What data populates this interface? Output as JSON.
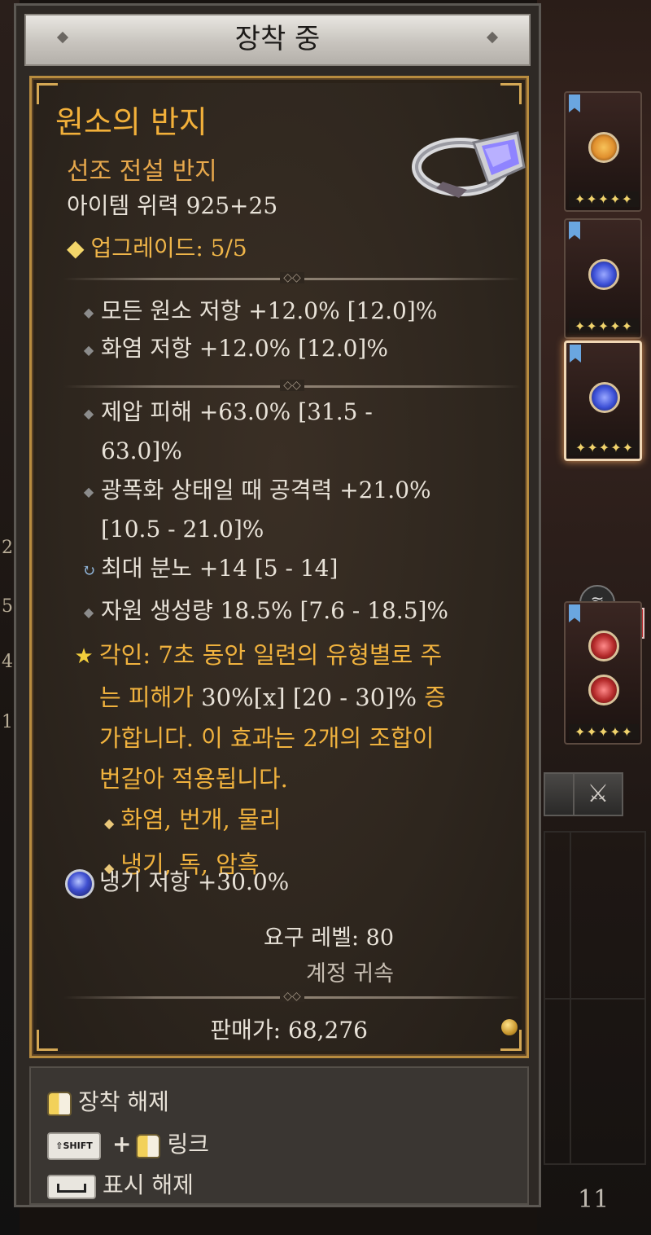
{
  "window": {
    "title": "장착 중"
  },
  "item": {
    "name": "원소의 반지",
    "type": "선조 전설 반지",
    "power": "아이템 위력 925+25",
    "upgrade": "업그레이드: 5/5",
    "name_color": "#f2b03a",
    "type_color": "#e7a84c"
  },
  "stats_group1": [
    {
      "text": "모든 원소 저항 +12.0% [12.0]%",
      "icon": "diamond-bullet-icon"
    },
    {
      "text": "화염 저항 +12.0% [12.0]%",
      "icon": "diamond-bullet-icon"
    }
  ],
  "stats_group2": [
    {
      "line1": "제압 피해 +63.0% [31.5 -",
      "line2": "63.0]%",
      "icon": "diamond-bullet-icon"
    },
    {
      "line1": "광폭화 상태일 때 공격력 +21.0%",
      "line2": "[10.5 - 21.0]%",
      "icon": "diamond-bullet-icon"
    },
    {
      "text": "최대 분노 +14 [5 - 14]",
      "icon": "reroll-cycle-icon"
    },
    {
      "text": "자원 생성량 18.5% [7.6 - 18.5]%",
      "icon": "diamond-bullet-icon"
    }
  ],
  "aspect": {
    "icon": "star-icon",
    "part1": "각인: 7초 동안 일련의 유형별로 주",
    "part2a": "는 피해가 ",
    "part2_white": "30%[x] [20 - 30]%",
    "part2b": " 증",
    "part3": "가합니다. 이 효과는 2개의 조합이",
    "part4": "번갈아 적용됩니다.",
    "combo1": "화염, 번개, 물리",
    "combo2": "냉기, 독, 암흑",
    "color": "#f0b23e"
  },
  "socket": {
    "text": "냉기 저항 +30.0%",
    "gem_icon": "sapphire-gem-icon"
  },
  "footer": {
    "required_level": "요구 레벨: 80",
    "bound": "계정 귀속",
    "sell_price": "판매가: 68,276",
    "coin_icon": "gold-coin-icon"
  },
  "controls": {
    "unequip": "장착 해제",
    "shift_key": "SHIFT",
    "plus": "+",
    "link": "링크",
    "hide": "표시 해제"
  },
  "side_cards": [
    {
      "stars": "✦✦✦✦✦",
      "gem_color": "#e0902e"
    },
    {
      "stars": "✦✦✦✦✦",
      "gem_color": "#3b4fd6"
    },
    {
      "stars": "✦✦✦✦✦",
      "gem_color": "#3b4fd6"
    },
    {
      "stars": "✦✦✦✦✦",
      "gem_color": "#b42a2a"
    }
  ],
  "page_number": "11",
  "side_numbers": [
    "2",
    "5",
    "4",
    "1"
  ]
}
